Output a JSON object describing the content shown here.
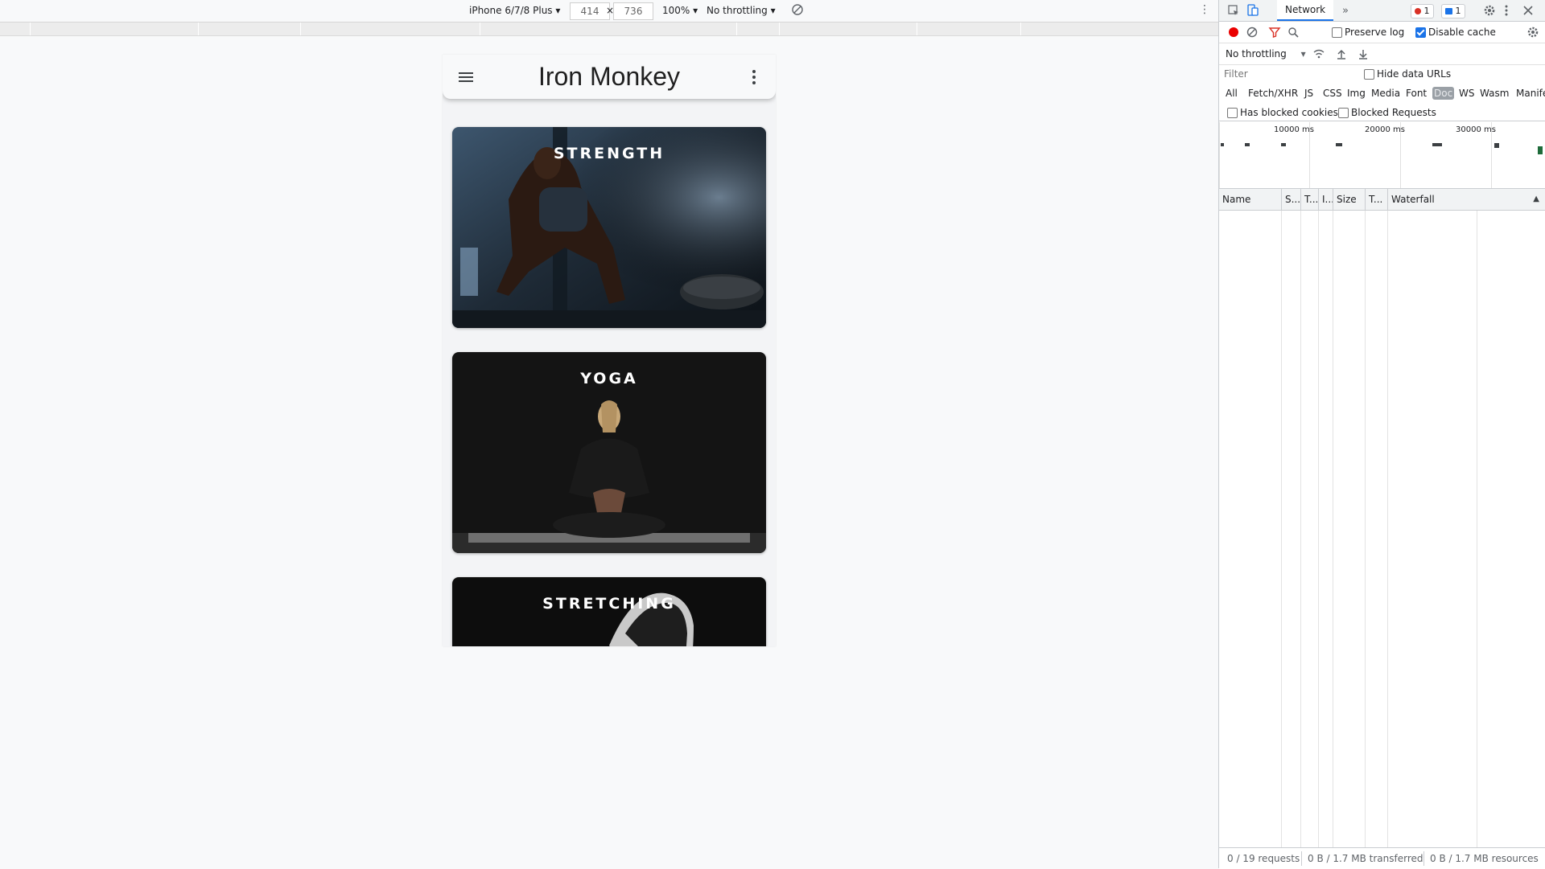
{
  "device_toolbar": {
    "device": "iPhone 6/7/8 Plus",
    "width": "414",
    "times": "×",
    "height": "736",
    "zoom": "100%",
    "throttling": "No throttling",
    "dropdown_glyph": "▾",
    "more_glyph": "⋮"
  },
  "app": {
    "title": "Iron Monkey",
    "cards": [
      {
        "label": "STRENGTH",
        "accent": "#2f4f6f"
      },
      {
        "label": "YOGA",
        "accent": "#141414"
      },
      {
        "label": "STRETCHING",
        "accent": "#0d0d0d"
      }
    ]
  },
  "devtools": {
    "active_tab": "Network",
    "overflow_glyph": "»",
    "errors_count": "1",
    "messages_count": "1",
    "error_color": "#d93025",
    "message_color": "#1a73e8",
    "preserve_log": {
      "label": "Preserve log",
      "checked": false
    },
    "disable_cache": {
      "label": "Disable cache",
      "checked": true
    },
    "throttling": "No throttling",
    "filter_placeholder": "Filter",
    "hide_data_urls": {
      "label": "Hide data URLs",
      "checked": false
    },
    "types": [
      "All",
      "Fetch/XHR",
      "JS",
      "CSS",
      "Img",
      "Media",
      "Font",
      "Doc",
      "WS",
      "Wasm",
      "Manife"
    ],
    "selected_type": "Doc",
    "has_blocked_cookies": {
      "label": "Has blocked cookies",
      "checked": false
    },
    "blocked_requests": {
      "label": "Blocked Requests",
      "checked": false
    },
    "overview_ticks": [
      "10000 ms",
      "20000 ms",
      "30000 ms"
    ],
    "columns": [
      "Name",
      "S...",
      "T...",
      "I...",
      "Size",
      "T...",
      "Waterfall"
    ],
    "sort_glyph": "▲",
    "status": {
      "requests": "0 / 19 requests",
      "transferred": "0 B / 1.7 MB transferred",
      "resources": "0 B / 1.7 MB resources"
    }
  }
}
